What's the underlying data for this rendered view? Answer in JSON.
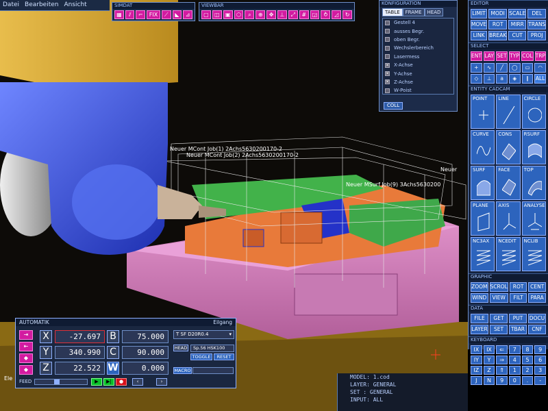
{
  "menu": {
    "items": [
      "Datei",
      "Bearbeiten",
      "Ansicht"
    ]
  },
  "simdat": {
    "title": "SIMDAT",
    "fix_label": "FIX"
  },
  "viewbar": {
    "title": "VIEWBAR"
  },
  "config": {
    "title": "KONFIGURATION",
    "tabs": [
      "TABLE",
      "FRAME",
      "HEAD"
    ],
    "items": [
      {
        "label": "Gestell 4",
        "checked": false
      },
      {
        "label": "ausses Begr.",
        "checked": false
      },
      {
        "label": "oben Begr.",
        "checked": false
      },
      {
        "label": "Wechslerbereich",
        "checked": false
      },
      {
        "label": "Lasermess",
        "checked": false
      },
      {
        "label": "X-Achse",
        "checked": true
      },
      {
        "label": "Y-Achse",
        "checked": true
      },
      {
        "label": "Z-Achse",
        "checked": true
      },
      {
        "label": "W-Poist",
        "checked": false
      }
    ],
    "coll_label": "COLL"
  },
  "viewport_labels": {
    "job1": "Neuer MCont Job(2) 2Achs5630200170-2",
    "job1b": "Neuer MCont Job(1) 2Achs5630200170-2",
    "job2": "Neuer MSurf Job(9) 3Achs5630200",
    "job3": "Neuer",
    "bottom_left": "Ele"
  },
  "editor": {
    "title": "EDITOR",
    "buttons": [
      "LIMIT",
      "MODI",
      "SCALE",
      "DEL",
      "MOVE",
      "ROT",
      "MIRR",
      "TRANS",
      "LINK",
      "BREAK",
      "CUT",
      "PROJ"
    ]
  },
  "select": {
    "title": "SELECT",
    "buttons": [
      "ENT",
      "LAY",
      "SET",
      "TYP",
      "COL",
      "TRP"
    ],
    "all_label": "ALL"
  },
  "entity": {
    "title": "ENTITY CADCAM",
    "buttons": [
      "POINT",
      "LINE",
      "CIRCLE",
      "CURVE",
      "CONS",
      "RSURF",
      "SURF",
      "FACE",
      "TOP",
      "PLANE",
      "AXIS",
      "ANALYSE",
      "NC3AX",
      "NCEDIT",
      "NCLIB"
    ]
  },
  "graphic": {
    "title": "GRAPHIC",
    "buttons": [
      "ZOOM",
      "SCROL",
      "ROT",
      "CENT",
      "WIND",
      "VIEW",
      "FILT",
      "PARA"
    ]
  },
  "data": {
    "title": "DATA",
    "buttons": [
      "FILE",
      "GET",
      "PUT",
      "DOCU",
      "LAYER",
      "SET",
      "TBAR",
      "CNF"
    ]
  },
  "keyboard": {
    "title": "KEYBOARD",
    "keys": [
      "IX",
      "IX",
      "⇐",
      "7",
      "8",
      "9",
      "IY",
      "Y",
      "⇒",
      "4",
      "5",
      "6",
      "IZ",
      "Z",
      "⇑",
      "1",
      "2",
      "3",
      "J",
      "N",
      "9",
      "0",
      ".",
      "-"
    ]
  },
  "automatik": {
    "title": "AUTOMATIK",
    "status": "Eilgang",
    "axes": [
      {
        "name": "X",
        "value": "-27.697"
      },
      {
        "name": "Y",
        "value": "340.990"
      },
      {
        "name": "Z",
        "value": "22.522"
      }
    ],
    "rot_axes": [
      {
        "name": "B",
        "value": "75.000"
      },
      {
        "name": "C",
        "value": "90.000"
      },
      {
        "name": "W",
        "value": "0.000"
      }
    ],
    "tool": "T SF D20R0.4",
    "head_label": "HEAD",
    "spindle": "Sp.56 HSK100",
    "toggle_label": "TOGGLE",
    "reset_label": "RESET",
    "macro_label": "MACRO",
    "feed_label": "FEED"
  },
  "info": {
    "lines": [
      "MODEL: 1.cod",
      "LAYER: GENERAL",
      "SET  : GENERAL",
      "INPUT: ALL"
    ]
  }
}
